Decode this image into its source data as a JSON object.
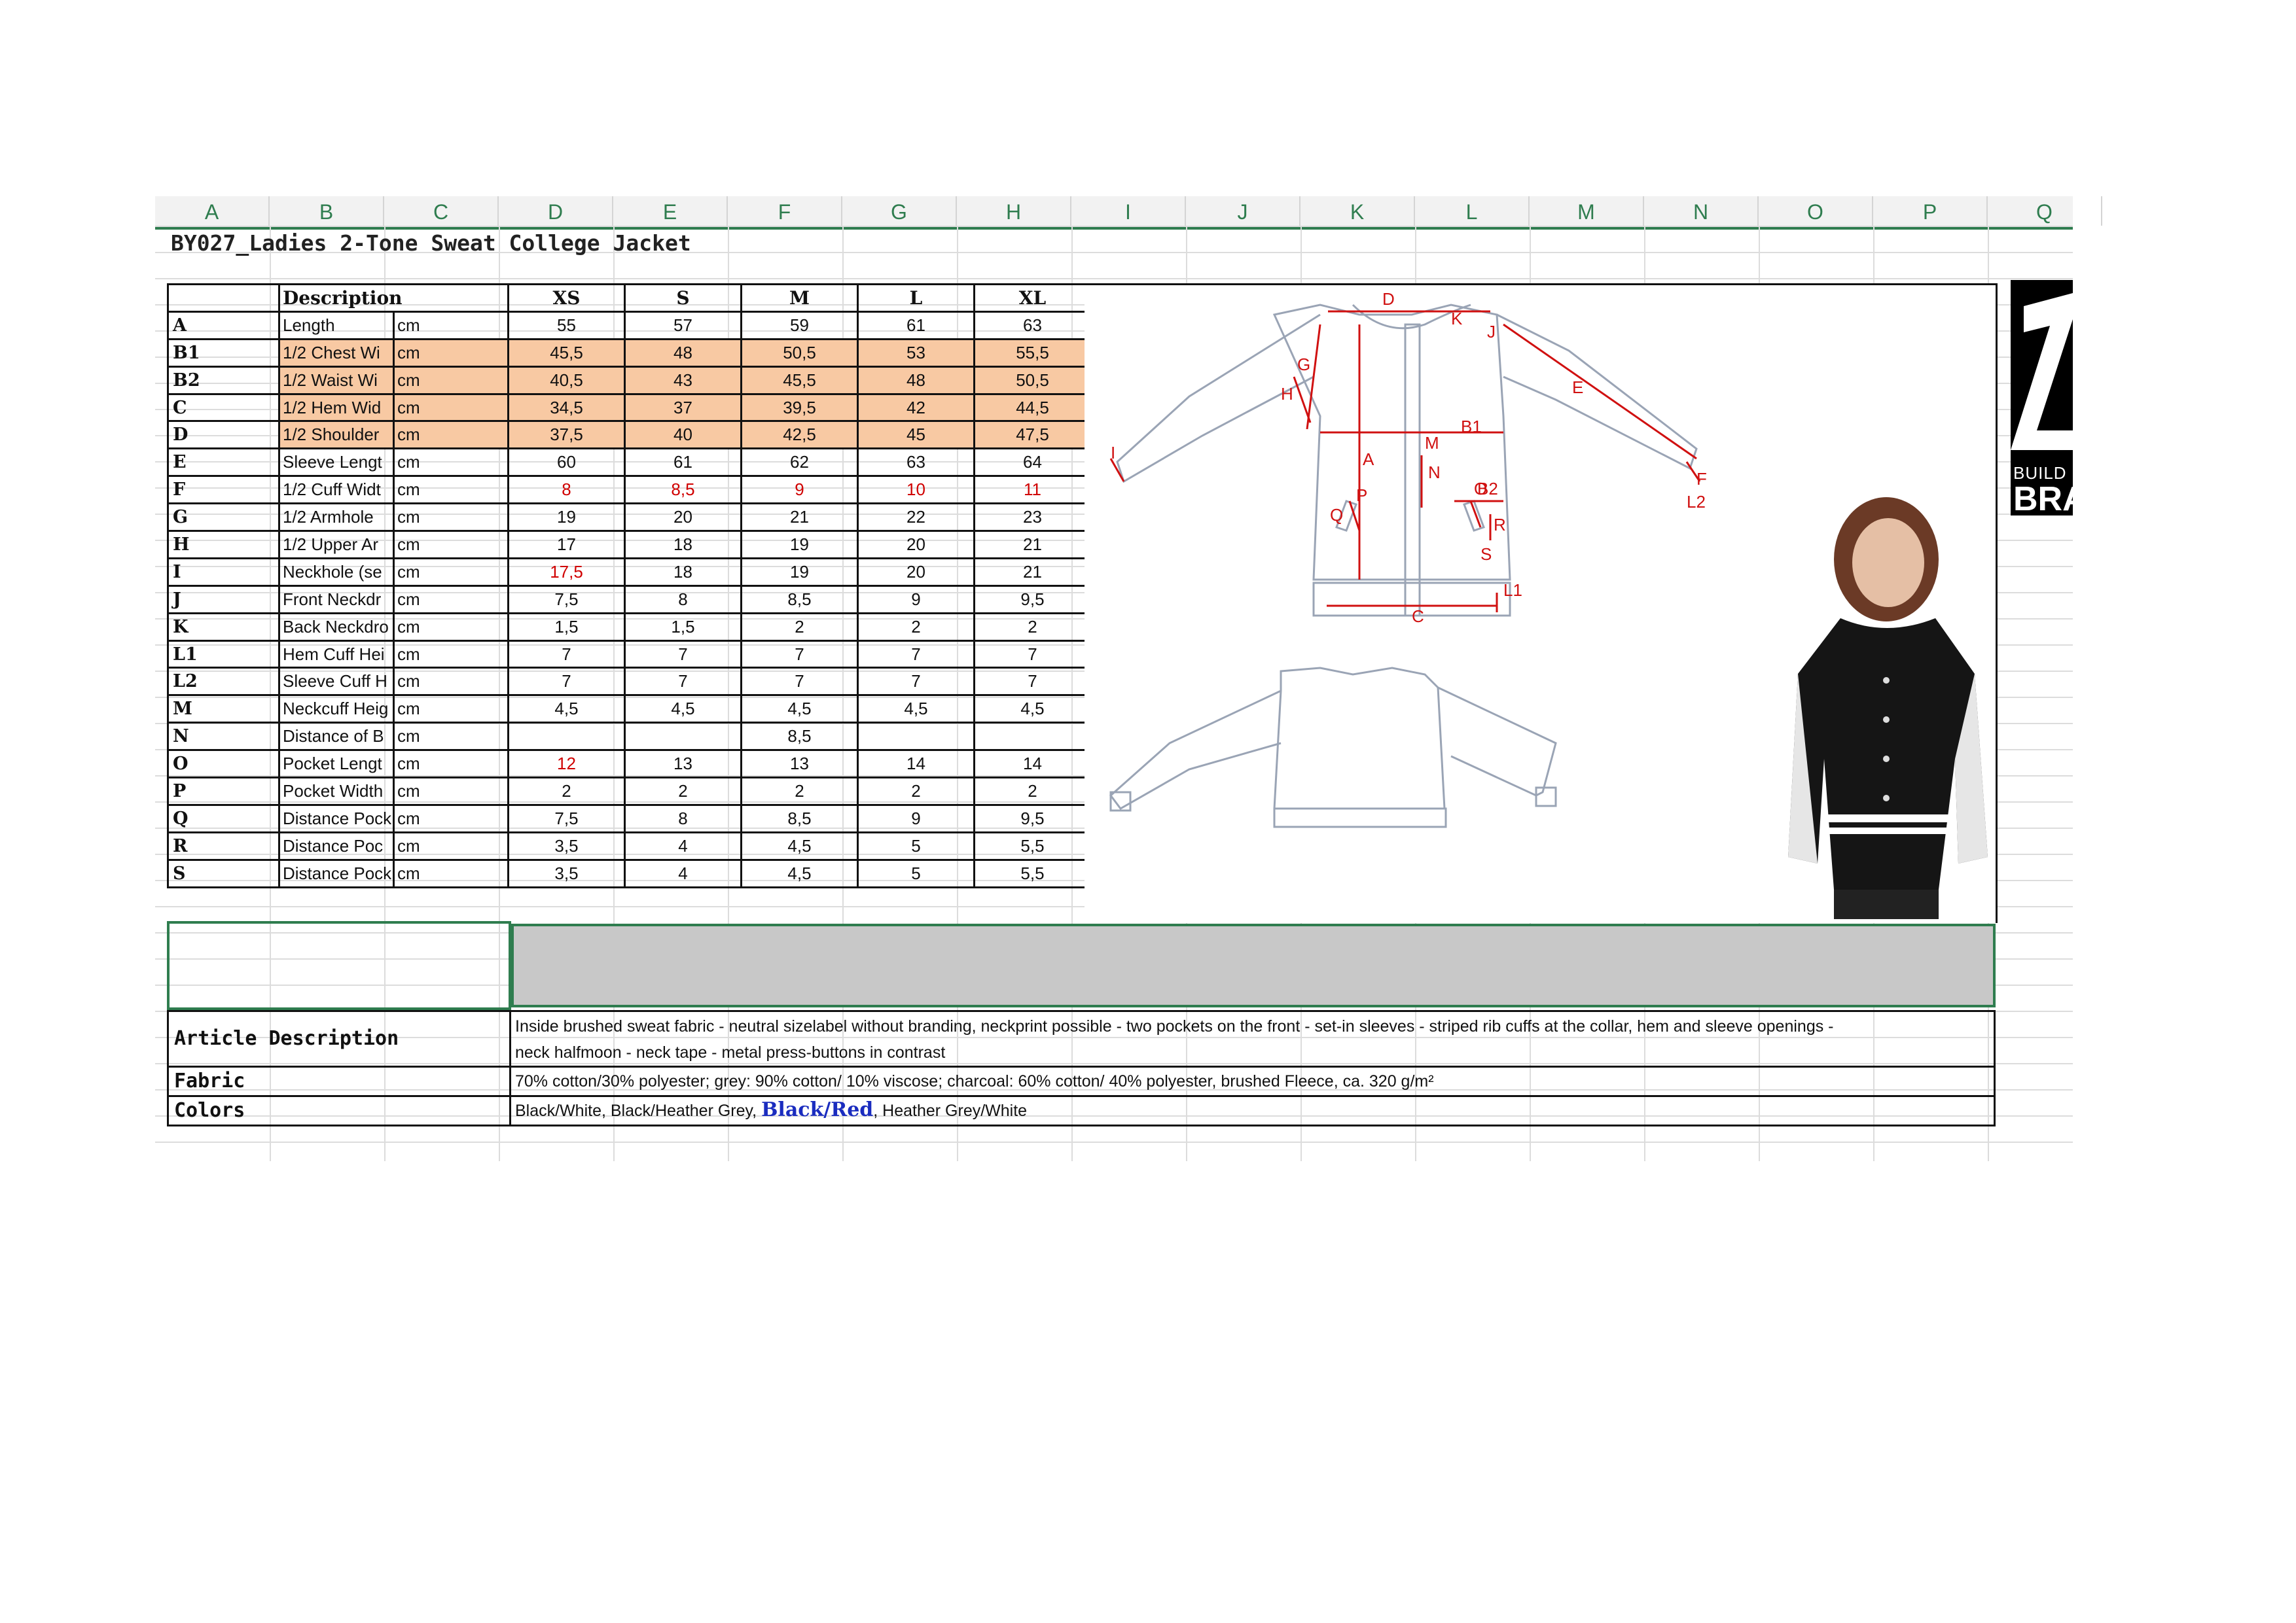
{
  "columns": [
    "A",
    "B",
    "C",
    "D",
    "E",
    "F",
    "G",
    "H",
    "I",
    "J",
    "K",
    "L",
    "M",
    "N",
    "O",
    "P",
    "Q"
  ],
  "title": "BY027_Ladies 2-Tone Sweat College Jacket",
  "table": {
    "header": {
      "desc": "Description",
      "sizes": [
        "XS",
        "S",
        "M",
        "L",
        "XL"
      ]
    },
    "rows": [
      {
        "code": "A",
        "desc": "Length",
        "unit": "cm",
        "values": [
          "55",
          "57",
          "59",
          "61",
          "63"
        ],
        "highlight": false,
        "red": []
      },
      {
        "code": "B1",
        "desc": "1/2 Chest Wi",
        "unit": "cm",
        "values": [
          "45,5",
          "48",
          "50,5",
          "53",
          "55,5"
        ],
        "highlight": true,
        "red": []
      },
      {
        "code": "B2",
        "desc": "1/2 Waist Wi",
        "unit": "cm",
        "values": [
          "40,5",
          "43",
          "45,5",
          "48",
          "50,5"
        ],
        "highlight": true,
        "red": []
      },
      {
        "code": "C",
        "desc": "1/2 Hem Wid",
        "unit": "cm",
        "values": [
          "34,5",
          "37",
          "39,5",
          "42",
          "44,5"
        ],
        "highlight": true,
        "red": []
      },
      {
        "code": "D",
        "desc": "1/2 Shoulder",
        "unit": "cm",
        "values": [
          "37,5",
          "40",
          "42,5",
          "45",
          "47,5"
        ],
        "highlight": true,
        "red": []
      },
      {
        "code": "E",
        "desc": "Sleeve Lengt",
        "unit": "cm",
        "values": [
          "60",
          "61",
          "62",
          "63",
          "64"
        ],
        "highlight": false,
        "red": []
      },
      {
        "code": "F",
        "desc": "1/2 Cuff Widt",
        "unit": "cm",
        "values": [
          "8",
          "8,5",
          "9",
          "10",
          "11"
        ],
        "highlight": false,
        "red": [
          0,
          1,
          2,
          3,
          4
        ]
      },
      {
        "code": "G",
        "desc": "1/2 Armhole",
        "unit": "cm",
        "values": [
          "19",
          "20",
          "21",
          "22",
          "23"
        ],
        "highlight": false,
        "red": []
      },
      {
        "code": "H",
        "desc": "1/2 Upper Ar",
        "unit": "cm",
        "values": [
          "17",
          "18",
          "19",
          "20",
          "21"
        ],
        "highlight": false,
        "red": []
      },
      {
        "code": "I",
        "desc": "Neckhole (se",
        "unit": "cm",
        "values": [
          "17,5",
          "18",
          "19",
          "20",
          "21"
        ],
        "highlight": false,
        "red": [
          0
        ]
      },
      {
        "code": "J",
        "desc": "Front Neckdr",
        "unit": "cm",
        "values": [
          "7,5",
          "8",
          "8,5",
          "9",
          "9,5"
        ],
        "highlight": false,
        "red": []
      },
      {
        "code": "K",
        "desc": "Back Neckdro",
        "unit": "cm",
        "values": [
          "1,5",
          "1,5",
          "2",
          "2",
          "2"
        ],
        "highlight": false,
        "red": []
      },
      {
        "code": "L1",
        "desc": "Hem Cuff Hei",
        "unit": "cm",
        "values": [
          "7",
          "7",
          "7",
          "7",
          "7"
        ],
        "highlight": false,
        "red": []
      },
      {
        "code": "L2",
        "desc": "Sleeve Cuff H",
        "unit": "cm",
        "values": [
          "7",
          "7",
          "7",
          "7",
          "7"
        ],
        "highlight": false,
        "red": []
      },
      {
        "code": "M",
        "desc": "Neckcuff Heig",
        "unit": "cm",
        "values": [
          "4,5",
          "4,5",
          "4,5",
          "4,5",
          "4,5"
        ],
        "highlight": false,
        "red": []
      },
      {
        "code": "N",
        "desc": "Distance of B",
        "unit": "cm",
        "values": [
          "",
          "",
          "8,5",
          "",
          ""
        ],
        "highlight": false,
        "red": []
      },
      {
        "code": "O",
        "desc": "Pocket Lengt",
        "unit": "cm",
        "values": [
          "12",
          "13",
          "13",
          "14",
          "14"
        ],
        "highlight": false,
        "red": [
          0
        ]
      },
      {
        "code": "P",
        "desc": "Pocket Width",
        "unit": "cm",
        "values": [
          "2",
          "2",
          "2",
          "2",
          "2"
        ],
        "highlight": false,
        "red": []
      },
      {
        "code": "Q",
        "desc": "Distance Pock",
        "unit": "cm",
        "values": [
          "7,5",
          "8",
          "8,5",
          "9",
          "9,5"
        ],
        "highlight": false,
        "red": []
      },
      {
        "code": "R",
        "desc": "Distance Poc",
        "unit": "cm",
        "values": [
          "3,5",
          "4",
          "4,5",
          "5",
          "5,5"
        ],
        "highlight": false,
        "red": []
      },
      {
        "code": "S",
        "desc": "Distance Pock",
        "unit": "cm",
        "values": [
          "3,5",
          "4",
          "4,5",
          "5",
          "5,5"
        ],
        "highlight": false,
        "red": []
      }
    ]
  },
  "diagram_labels": [
    "D",
    "J",
    "K",
    "G",
    "H",
    "E",
    "I",
    "F",
    "A",
    "B1",
    "M",
    "N",
    "B2",
    "P",
    "O",
    "Q",
    "R",
    "S",
    "L1",
    "C",
    "L2"
  ],
  "logo": {
    "line1": "BUILD",
    "line2": "BRA"
  },
  "article": {
    "label": "Article Description",
    "line1": "Inside brushed sweat fabric - neutral sizelabel without branding, neckprint possible - two pockets on the front - set-in sleeves - striped rib cuffs at the collar, hem and sleeve openings -",
    "line2": "neck halfmoon -  neck tape - metal press-buttons in contrast"
  },
  "fabric": {
    "label": "Fabric",
    "text": "70% cotton/30% polyester; grey: 90% cotton/ 10% viscose; charcoal: 60% cotton/ 40% polyester, brushed Fleece, ca. 320 g/m²"
  },
  "colors": {
    "label": "Colors",
    "before": "Black/White, Black/Heather Grey, ",
    "highlight": "Black/Red",
    "after": ", Heather Grey/White"
  }
}
